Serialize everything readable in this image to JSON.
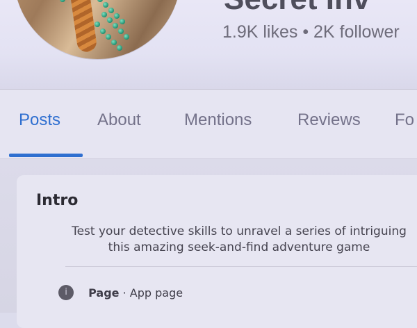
{
  "profile": {
    "name": "Secret Inv",
    "stats": "1.9K likes • 2K follower"
  },
  "tabs": [
    {
      "label": "Posts",
      "active": true
    },
    {
      "label": "About",
      "active": false
    },
    {
      "label": "Mentions",
      "active": false
    },
    {
      "label": "Reviews",
      "active": false
    },
    {
      "label": "Fo",
      "active": false
    }
  ],
  "intro": {
    "title": "Intro",
    "description_line1": "Test your detective skills to unravel a series of intriguing",
    "description_line2": "this amazing seek-and-find adventure game",
    "page_type_prefix": "Page",
    "page_type_separator": " · ",
    "page_type_category": "App page",
    "info_icon": "info-icon"
  },
  "colors": {
    "accent": "#2f6fd0",
    "background": "#e6e5f2",
    "text": "#2c2b33"
  }
}
